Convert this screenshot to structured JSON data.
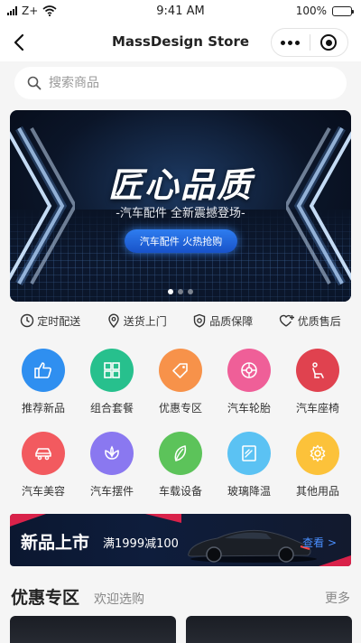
{
  "status": {
    "carrier": "Z+",
    "time": "9:41 AM",
    "battery": "100%"
  },
  "nav": {
    "title": "MassDesign Store"
  },
  "search": {
    "placeholder": "搜索商品"
  },
  "banner": {
    "headline": "匠心品质",
    "subline": "-汽车配件 全新震撼登场-",
    "cta": "汽车配件 火热抢购",
    "active_page": 1,
    "page_count": 3
  },
  "services": [
    {
      "label": "定时配送",
      "icon": "clock-icon"
    },
    {
      "label": "送货上门",
      "icon": "location-pin-icon"
    },
    {
      "label": "品质保障",
      "icon": "shield-icon"
    },
    {
      "label": "优质售后",
      "icon": "heart-plus-icon"
    }
  ],
  "categories": [
    {
      "label": "推荐新品",
      "icon": "thumbs-up-icon",
      "color": "#2f8ff0"
    },
    {
      "label": "组合套餐",
      "icon": "grid-icon",
      "color": "#27c08d"
    },
    {
      "label": "优惠专区",
      "icon": "tag-icon",
      "color": "#f7924a"
    },
    {
      "label": "汽车轮胎",
      "icon": "tire-icon",
      "color": "#ef5f98"
    },
    {
      "label": "汽车座椅",
      "icon": "seat-icon",
      "color": "#e0424f"
    },
    {
      "label": "汽车美容",
      "icon": "car-icon",
      "color": "#f25a5f"
    },
    {
      "label": "汽车摆件",
      "icon": "lotus-icon",
      "color": "#8a78f0"
    },
    {
      "label": "车载设备",
      "icon": "leaf-icon",
      "color": "#5cc35a"
    },
    {
      "label": "玻璃降温",
      "icon": "glass-icon",
      "color": "#5bc2f3"
    },
    {
      "label": "其他用品",
      "icon": "gear-icon",
      "color": "#fcc23a"
    }
  ],
  "promo": {
    "title": "新品上市",
    "subtitle": "满1999减100",
    "link": "查看 >"
  },
  "section": {
    "title": "优惠专区",
    "subtitle": "欢迎选购",
    "more": "更多"
  }
}
